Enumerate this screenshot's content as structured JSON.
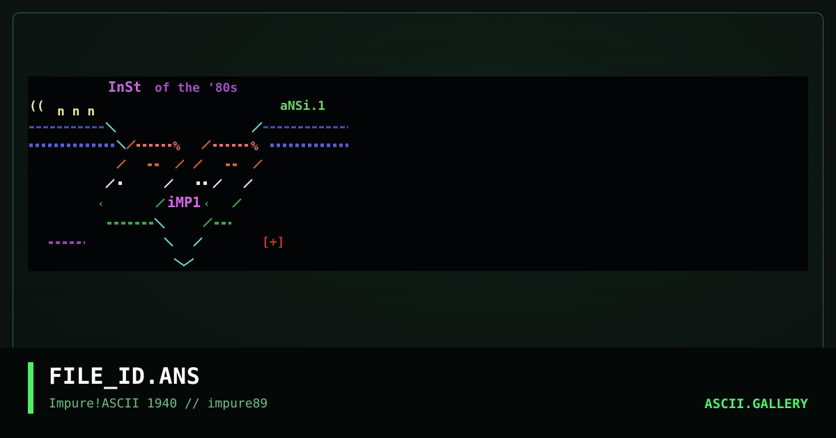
{
  "preview": {
    "art_lines": [
      {
        "text": "InSt",
        "color": "#c66ae0"
      },
      {
        "text": "of the '80s",
        "color": "#a24fc0"
      },
      {
        "text": "((",
        "color": "#e8e6a8"
      },
      {
        "text": "n n n",
        "color": "#e8e6a8"
      },
      {
        "text": "aNSi.1",
        "color": "#6fd36a"
      },
      {
        "text": "iMP1",
        "color": "#d46ae8"
      },
      {
        "text": "[+]",
        "color": "#c0392b"
      }
    ],
    "palette": {
      "blue": "#4a4fc4",
      "teal": "#6fd3c0",
      "orange": "#d0603a",
      "pink": "#e07070",
      "green": "#3aa84a",
      "white": "#e8e8e8",
      "purple": "#9a3fb0"
    }
  },
  "file": {
    "title": "FILE_ID.ANS",
    "subtitle": "Impure!ASCII 1940 // impure89"
  },
  "brand": {
    "label": "ASCII.GALLERY",
    "accent": "#4ef06a"
  }
}
